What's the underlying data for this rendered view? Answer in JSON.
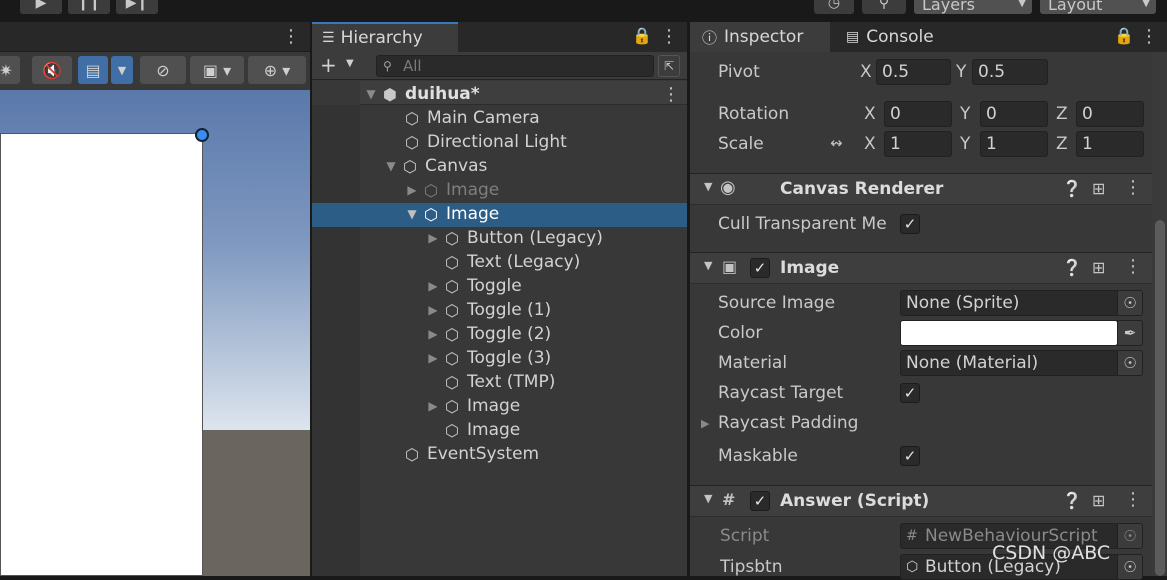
{
  "toolbar": {
    "layers_label": "Layers",
    "layout_label": "Layout"
  },
  "hierarchy": {
    "tab_label": "Hierarchy",
    "search_placeholder": "All",
    "scene_name": "duihua*",
    "items": [
      {
        "label": "Main Camera"
      },
      {
        "label": "Directional Light"
      },
      {
        "label": "Canvas"
      },
      {
        "label": "Image"
      },
      {
        "label": "Image"
      },
      {
        "label": "Button (Legacy)"
      },
      {
        "label": "Text (Legacy)"
      },
      {
        "label": "Toggle"
      },
      {
        "label": "Toggle (1)"
      },
      {
        "label": "Toggle (2)"
      },
      {
        "label": "Toggle (3)"
      },
      {
        "label": "Text (TMP)"
      },
      {
        "label": "Image"
      },
      {
        "label": "Image"
      },
      {
        "label": "EventSystem"
      }
    ]
  },
  "inspector": {
    "tab_label": "Inspector",
    "console_tab_label": "Console",
    "pivot": {
      "label": "Pivot",
      "x_label": "X",
      "x": "0.5",
      "y_label": "Y",
      "y": "0.5"
    },
    "rotation": {
      "label": "Rotation",
      "x_label": "X",
      "x": "0",
      "y_label": "Y",
      "y": "0",
      "z_label": "Z",
      "z": "0"
    },
    "scale": {
      "label": "Scale",
      "x_label": "X",
      "x": "1",
      "y_label": "Y",
      "y": "1",
      "z_label": "Z",
      "z": "1"
    },
    "canvas_renderer": {
      "title": "Canvas Renderer",
      "cull_label": "Cull Transparent Me",
      "cull_checked": true
    },
    "image": {
      "title": "Image",
      "source_image_label": "Source Image",
      "source_image_value": "None (Sprite)",
      "color_label": "Color",
      "color_value": "#ffffff",
      "material_label": "Material",
      "material_value": "None (Material)",
      "raycast_target_label": "Raycast Target",
      "raycast_padding_label": "Raycast Padding",
      "maskable_label": "Maskable"
    },
    "answer": {
      "title": "Answer (Script)",
      "script_label": "Script",
      "script_value": "NewBehaviourScript",
      "tipsbtn_label": "Tipsbtn",
      "tipsbtn_value": "Button (Legacy)"
    }
  },
  "watermark": "CSDN @ABC"
}
